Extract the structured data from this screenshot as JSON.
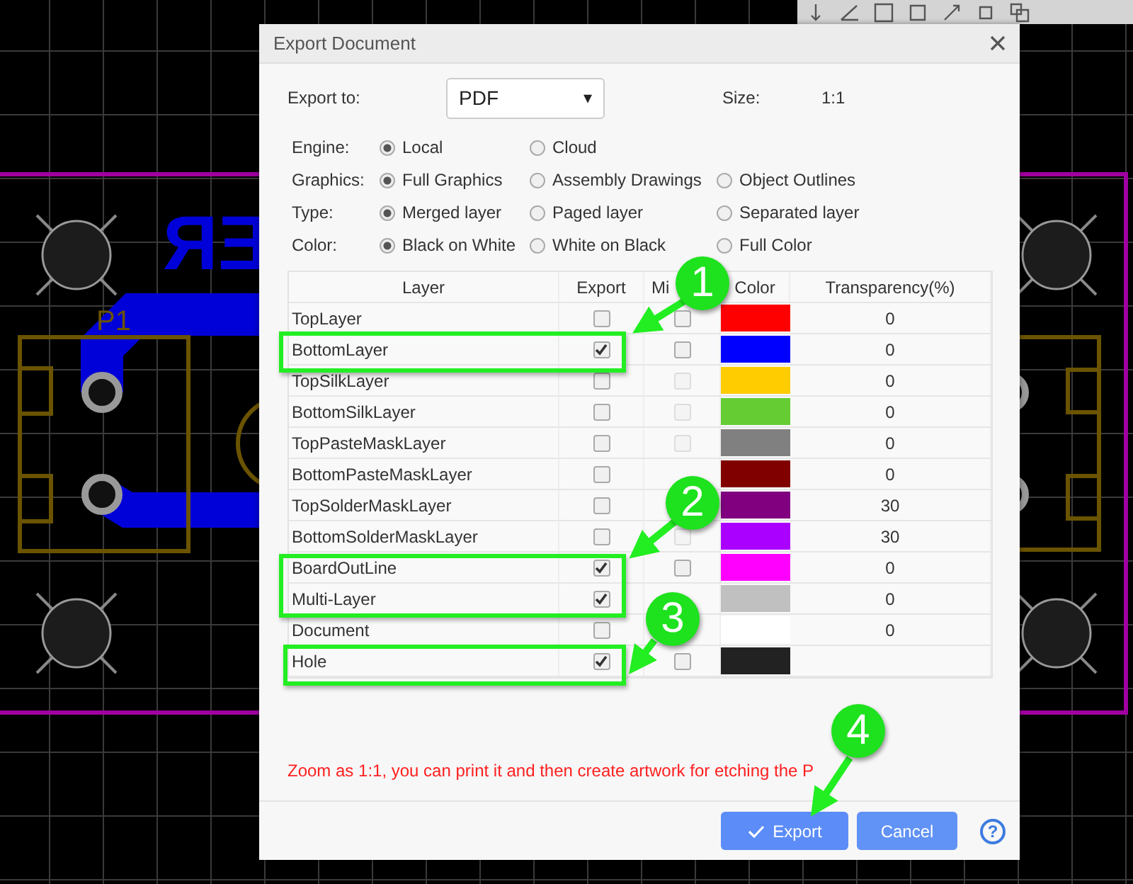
{
  "canvas": {
    "labels": [
      {
        "kind": "silkscreen",
        "text": "P1"
      },
      {
        "kind": "copper_mirrored",
        "text": "ЯƎ"
      }
    ]
  },
  "dialog": {
    "title": "Export Document",
    "export_to": {
      "label": "Export to:",
      "value": "PDF",
      "caret": "▾"
    },
    "size": {
      "label": "Size:",
      "value": "1:1"
    },
    "option_groups": [
      {
        "label": "Engine:",
        "options": [
          {
            "label": "Local",
            "selected": true
          },
          {
            "label": "Cloud",
            "selected": false
          }
        ]
      },
      {
        "label": "Graphics:",
        "options": [
          {
            "label": "Full Graphics",
            "selected": true
          },
          {
            "label": "Assembly Drawings",
            "selected": false
          },
          {
            "label": "Object Outlines",
            "selected": false
          }
        ]
      },
      {
        "label": "Type:",
        "options": [
          {
            "label": "Merged layer",
            "selected": true
          },
          {
            "label": "Paged layer",
            "selected": false
          },
          {
            "label": "Separated layer",
            "selected": false
          }
        ]
      },
      {
        "label": "Color:",
        "options": [
          {
            "label": "Black on White",
            "selected": true
          },
          {
            "label": "White on Black",
            "selected": false
          },
          {
            "label": "Full Color",
            "selected": false
          }
        ]
      }
    ],
    "table": {
      "columns": [
        "Layer",
        "Export",
        "Mi",
        "Color",
        "Transparency(%)"
      ],
      "rows": [
        {
          "layer": "TopLayer",
          "export": false,
          "mirror": {
            "checked": false,
            "disabled": false
          },
          "color": "#ff0000",
          "transparency": "0"
        },
        {
          "layer": "BottomLayer",
          "export": true,
          "mirror": {
            "checked": false,
            "disabled": false
          },
          "color": "#0000ff",
          "transparency": "0"
        },
        {
          "layer": "TopSilkLayer",
          "export": false,
          "mirror": {
            "checked": false,
            "disabled": true
          },
          "color": "#ffcc00",
          "transparency": "0"
        },
        {
          "layer": "BottomSilkLayer",
          "export": false,
          "mirror": {
            "checked": false,
            "disabled": true
          },
          "color": "#66cc33",
          "transparency": "0"
        },
        {
          "layer": "TopPasteMaskLayer",
          "export": false,
          "mirror": {
            "checked": false,
            "disabled": true
          },
          "color": "#808080",
          "transparency": "0"
        },
        {
          "layer": "BottomPasteMaskLayer",
          "export": false,
          "color": "#800000",
          "transparency": "0"
        },
        {
          "layer": "TopSolderMaskLayer",
          "export": false,
          "color": "#800080",
          "transparency": "30"
        },
        {
          "layer": "BottomSolderMaskLayer",
          "export": false,
          "mirror": {
            "checked": false,
            "disabled": true
          },
          "color": "#aa00ff",
          "transparency": "30"
        },
        {
          "layer": "BoardOutLine",
          "export": true,
          "mirror": {
            "checked": false,
            "disabled": false
          },
          "color": "#ff00ff",
          "transparency": "0"
        },
        {
          "layer": "Multi-Layer",
          "export": true,
          "color": "#c0c0c0",
          "transparency": "0"
        },
        {
          "layer": "Document",
          "export": false,
          "color": "#ffffff",
          "transparency": "0"
        },
        {
          "layer": "Hole",
          "export": true,
          "mirror": {
            "checked": false,
            "disabled": false
          },
          "color": "#222222"
        }
      ]
    },
    "note": "Zoom as 1:1, you can print it and then create artwork for etching the P",
    "buttons": [
      {
        "kind": "primary",
        "label": "Export"
      },
      {
        "kind": "secondary",
        "label": "Cancel"
      }
    ],
    "help": "?"
  },
  "annotations": [
    "1",
    "2",
    "3",
    "4"
  ]
}
